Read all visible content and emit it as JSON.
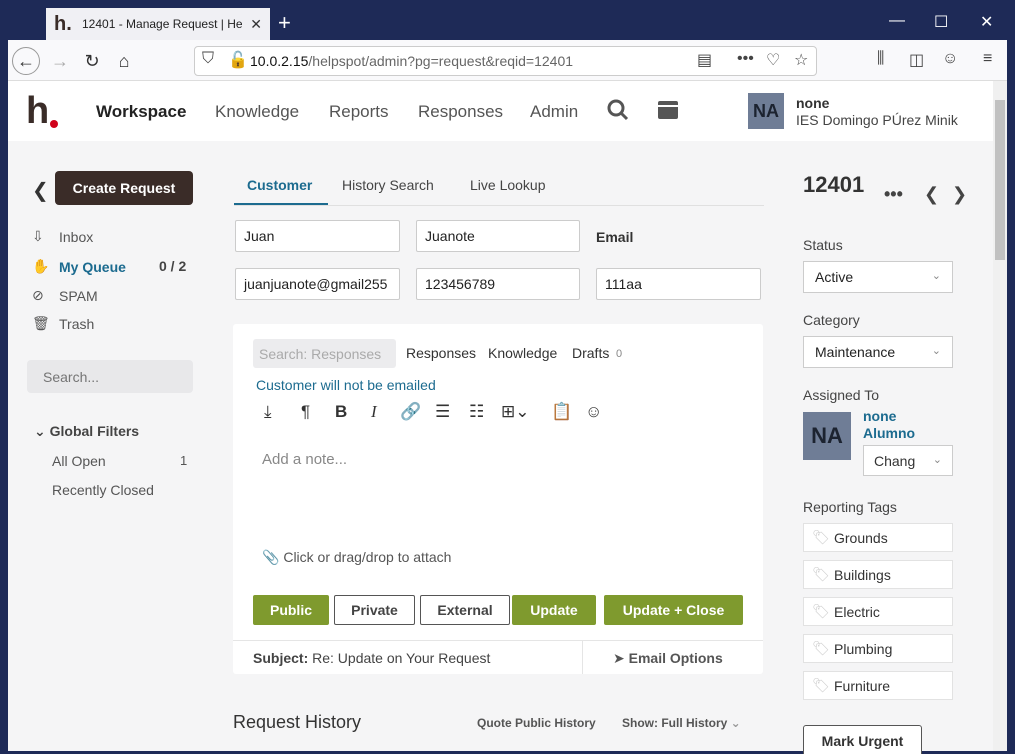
{
  "browser": {
    "tab_title": "12401 - Manage Request | HelpSpot",
    "tab_logo": "h.",
    "new_tab": "+",
    "close_tab": "✕",
    "url_host": "10.0.2.15",
    "url_path": "/helpspot/admin?pg=request&reqid=12401"
  },
  "app": {
    "logo": "h",
    "nav": [
      "Workspace",
      "Knowledge",
      "Reports",
      "Responses",
      "Admin"
    ],
    "user_initials": "NA",
    "user_name": "none",
    "user_org": "IES Domingo PÚrez Minik"
  },
  "sidebar": {
    "create_label": "Create Request",
    "items": [
      {
        "label": "Inbox",
        "icon": "inbox-icon"
      },
      {
        "label": "My Queue",
        "icon": "hand-icon"
      },
      {
        "label": "SPAM",
        "icon": "spam-icon"
      },
      {
        "label": "Trash",
        "icon": "trash-icon"
      }
    ],
    "queue_count": "0 / 2",
    "search_placeholder": "Search...",
    "filters_title": "Global Filters",
    "filters": [
      {
        "label": "All Open",
        "count": "1"
      },
      {
        "label": "Recently Closed"
      }
    ]
  },
  "customer": {
    "tabs": [
      "Customer",
      "History Search",
      "Live Lookup"
    ],
    "first_name": "Juan",
    "last_name": "Juanote",
    "email_label": "Email",
    "email": "juanjuanote@gmail255",
    "phone": "123456789",
    "customer_id": "111aa"
  },
  "editor": {
    "search_placeholder": "Search: Responses",
    "links": [
      "Responses",
      "Knowledge",
      "Drafts"
    ],
    "drafts_count": "0",
    "not_emailed": "Customer will not be emailed",
    "note_placeholder": "Add a note...",
    "attach_label": "Click or drag/drop to attach",
    "buttons": {
      "public": "Public",
      "private": "Private",
      "external": "External",
      "update": "Update",
      "update_close": "Update + Close"
    },
    "subject_label": "Subject:",
    "subject_value": "Re: Update on Your Request",
    "email_options": "Email Options"
  },
  "history": {
    "title": "Request History",
    "quote": "Quote Public History",
    "show": "Show: Full History"
  },
  "request": {
    "id": "12401",
    "status_label": "Status",
    "status": "Active",
    "category_label": "Category",
    "category": "Maintenance",
    "assigned_label": "Assigned To",
    "assignee_initials": "NA",
    "assignee_first": "none",
    "assignee_last": "Alumno",
    "change_label": "Chang",
    "tags_label": "Reporting Tags",
    "tags": [
      "Grounds",
      "Buildings",
      "Electric",
      "Plumbing",
      "Furniture"
    ],
    "urgent_label": "Mark Urgent"
  },
  "colors": {
    "accent": "#1c6b8f",
    "brand": "#3a2c28",
    "green": "#7f9a2e"
  }
}
